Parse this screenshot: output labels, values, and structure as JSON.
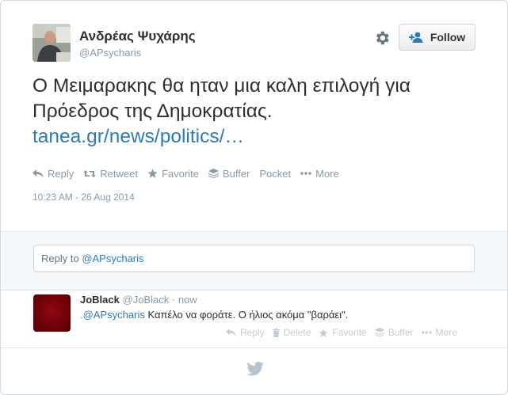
{
  "tweet": {
    "author_name": "Ανδρέας Ψυχάρης",
    "author_handle": "@APsycharis",
    "text": "Ο Μειμαρακης θα ηταν μια καλη επιλογή για Πρόεδρος της Δημοκρατίας.",
    "link_text": "tanea.gr/news/politics/…",
    "timestamp": "10:23 AM - 26 Aug 2014"
  },
  "header": {
    "follow_label": "Follow",
    "gear_icon": "gear-icon"
  },
  "actions": {
    "reply": "Reply",
    "retweet": "Retweet",
    "favorite": "Favorite",
    "buffer": "Buffer",
    "pocket": "Pocket",
    "more": "More"
  },
  "reply_box": {
    "prefix": "Reply to ",
    "mention": "@APsycharis"
  },
  "reply": {
    "name": "JoBlack",
    "handle": "@JoBlack",
    "separator": "·",
    "time": "now",
    "mention": ".@APsycharis",
    "text": " Καπέλο να φοράτε. Ο ήλιος ακόμα \"βαράει\".",
    "actions": {
      "reply": "Reply",
      "delete": "Delete",
      "favorite": "Favorite",
      "buffer": "Buffer",
      "more": "More"
    }
  },
  "colors": {
    "link": "#2b7bb9",
    "muted": "#8899a6",
    "text": "#292f33"
  }
}
